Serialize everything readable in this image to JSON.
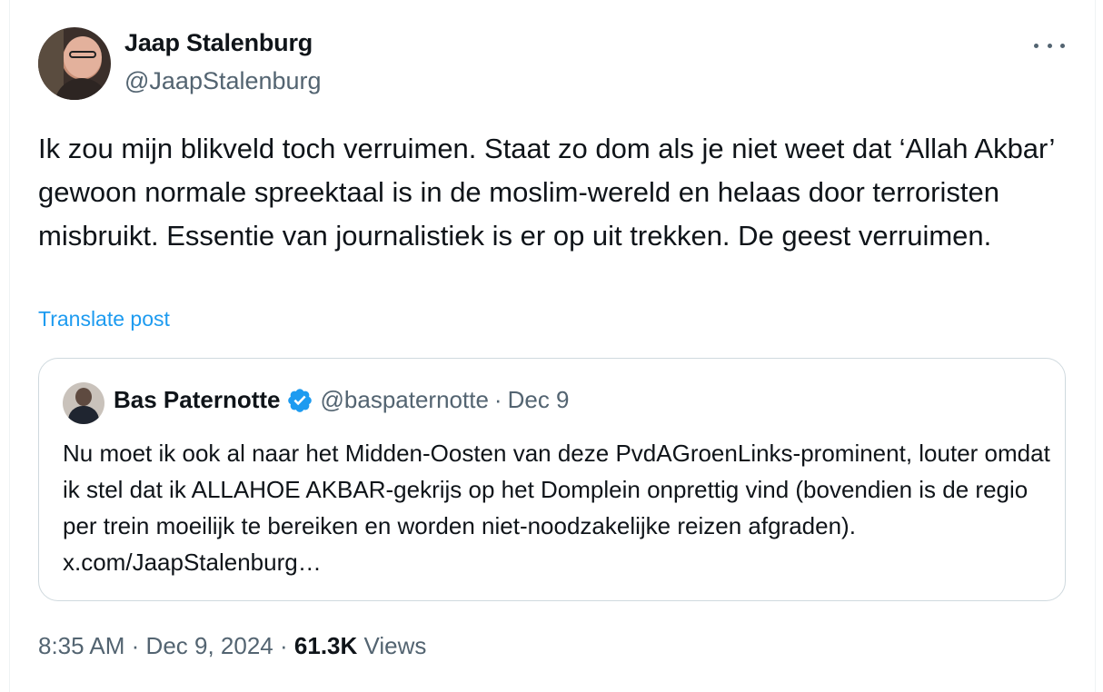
{
  "author": {
    "name": "Jaap Stalenburg",
    "handle": "@JaapStalenburg"
  },
  "post": {
    "text": "Ik zou mijn blikveld toch verruimen. Staat zo dom als je niet weet dat ‘Allah Akbar’ gewoon normale spreektaal is in de moslim-wereld en helaas door terroristen misbruikt. Essentie van journalistiek is er op uit trekken. De geest verruimen.",
    "translate_label": "Translate post"
  },
  "quote": {
    "name": "Bas Paternotte",
    "handle": "@baspaternotte",
    "separator": "·",
    "date": "Dec 9",
    "text": "Nu moet ik ook al naar het Midden-Oosten van deze PvdAGroenLinks-prominent, louter omdat ik stel dat ik ALLAHOE AKBAR-gekrijs op het Domplein onprettig vind (bovendien is de regio per trein moeilijk te bereiken en worden niet-noodzakelijke reizen afgraden). x.com/JaapStalenburg…",
    "verified_color": "#1d9bf0"
  },
  "meta": {
    "time": "8:35 AM",
    "separator": "·",
    "date": "Dec 9, 2024",
    "views_count": "61.3K",
    "views_label": "Views"
  },
  "icons": {
    "more": "more-horizontal-icon",
    "verified": "verified-badge-icon"
  },
  "colors": {
    "link": "#1d9bf0",
    "secondary_text": "#536471",
    "primary_text": "#0f1419",
    "border": "#cfd9de"
  }
}
